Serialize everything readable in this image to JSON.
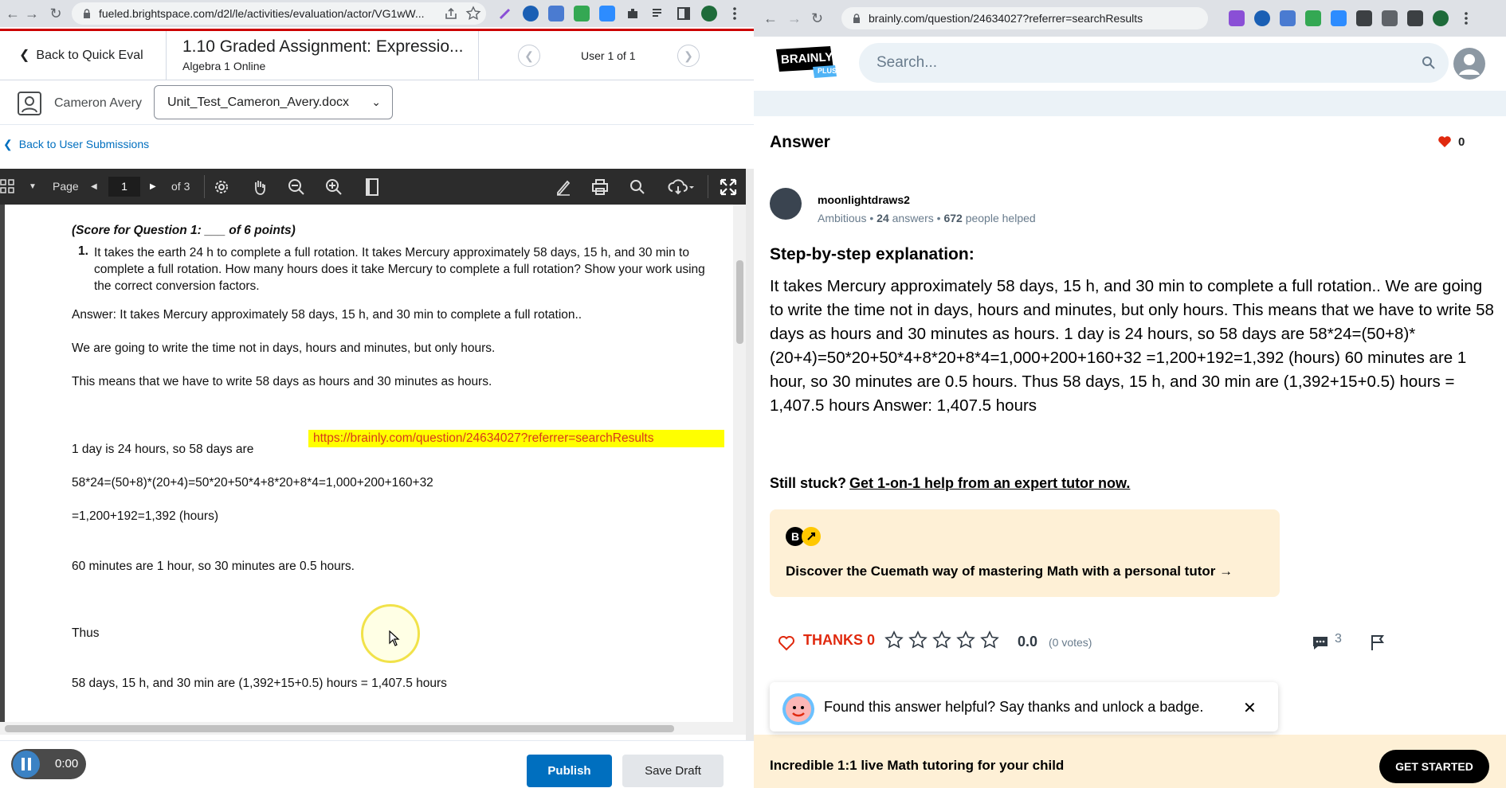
{
  "left_browser": {
    "url": "fueled.brightspace.com/d2l/le/activities/evaluation/actor/VG1wW..."
  },
  "left_header": {
    "back_quick_eval": "Back to Quick Eval",
    "assignment_title": "1.10 Graded Assignment: Expressio...",
    "course": "Algebra 1 Online",
    "user_of": "User 1 of 1"
  },
  "user_bar": {
    "user_name": "Cameron Avery",
    "file_name": "Unit_Test_Cameron_Avery.docx"
  },
  "back_user_submissions": "Back to User Submissions",
  "pdf_toolbar": {
    "page_label": "Page",
    "page_number": "1",
    "page_total": "of 3"
  },
  "document": {
    "score_line": "(Score for Question 1: ___ of 6 points)",
    "question_number": "1.",
    "question_text": "It takes the earth 24 h to complete a full rotation. It takes Mercury approximately 58 days, 15 h, and 30 min to complete a full rotation. How many hours does it take Mercury to complete a full rotation? Show your work using the correct conversion factors.",
    "answer_line": "Answer: It takes Mercury approximately 58 days, 15 h, and 30 min to complete a full rotation..",
    "line2": "We are going to write the time not in days, hours and minutes, but only hours.",
    "line3": "This means that we have to write 58 days as hours and 30 minutes as hours.",
    "link": "https://brainly.com/question/24634027?referrer=searchResults",
    "line4": "1 day is 24 hours, so 58 days are",
    "line5": "58*24=(50+8)*(20+4)=50*20+50*4+8*20+8*4=1,000+200+160+32",
    "line6": "=1,200+192=1,392  (hours)",
    "line7": "60 minutes are 1 hour, so 30 minutes are 0.5 hours.",
    "line8": "Thus",
    "line9": "58 days, 15 h, and 30 min are (1,392+15+0.5) hours = 1,407.5 hours"
  },
  "footer": {
    "recording_time": "0:00",
    "publish": "Publish",
    "save_draft": "Save Draft"
  },
  "right_browser": {
    "url": "brainly.com/question/24634027?referrer=searchResults"
  },
  "brainly": {
    "logo_text": "BRAINLY",
    "logo_sub": "PLUS",
    "search_placeholder": "Search...",
    "answer_heading": "Answer",
    "heart_count": "0",
    "author": {
      "name": "moonlightdraws2",
      "rank": "Ambitious",
      "answers_count": "24",
      "answers_label": "answers",
      "helped_count": "672",
      "helped_label": "people helped"
    },
    "step_heading": "Step-by-step explanation:",
    "explanation": "It takes Mercury approximately 58 days, 15 h, and 30 min to complete a full rotation.. We are going to write the time not in days, hours and minutes, but only hours. This means that we have to write 58 days as hours and 30 minutes as hours. 1 day is 24 hours, so 58 days are 58*24=(50+8)*(20+4)=50*20+50*4+8*20+8*4=1,000+200+160+32 =1,200+192=1,392 (hours) 60 minutes are 1 hour, so 30 minutes are 0.5 hours. Thus 58 days, 15 h, and 30 min are (1,392+15+0.5) hours = 1,407.5 hours Answer: 1,407.5 hours",
    "still_stuck": "Still stuck?",
    "still_link": "Get 1-on-1 help from an expert tutor now.",
    "cuemath_text": "Discover the Cuemath way of mastering Math with a personal tutor →",
    "cuemath_logo_letter": "B",
    "thanks_label": "THANKS 0",
    "rating": "0.0",
    "votes": "(0 votes)",
    "comments_count": "3",
    "toast_message": "Found this answer helpful? Say thanks and unlock a badge.",
    "tutor_bar_text": "Incredible 1:1 live Math tutoring for your child",
    "get_started": "GET STARTED",
    "accent_red": "#e0290e",
    "cream": "#fef0d6"
  }
}
